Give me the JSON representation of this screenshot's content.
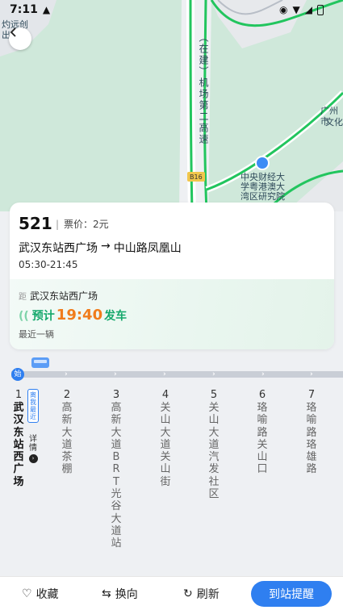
{
  "status_bar": {
    "time": "7:11"
  },
  "map": {
    "labels": {
      "top_left_1": "灼远创",
      "top_left_2": "出",
      "expressway": "（在建）机场第二高速",
      "road_shield": "B16",
      "poi_1": "中央财经大",
      "poi_2": "学粤港澳大",
      "poi_3": "湾区研究院",
      "right_1": "广州市",
      "right_2": "文化"
    }
  },
  "card": {
    "route_number": "521",
    "fare": "票价：2元",
    "origin": "武汉东站西广场",
    "arrow": "→",
    "destination": "中山路凤凰山",
    "hours": "05:30-21:45",
    "eta": {
      "station_tag": "距",
      "station": "武汉东站西广场",
      "prefix": "预计",
      "time": "19:40",
      "suffix": "发车",
      "sub": "最近一辆"
    }
  },
  "line": {
    "start_badge": "始",
    "nearest_badge": "离我最近",
    "detail": "详情",
    "stops": [
      {
        "num": "1",
        "name": "武汉东站西广场"
      },
      {
        "num": "2",
        "name": "高新大道茶棚"
      },
      {
        "num": "3",
        "name": "高新大道BRT光谷大道站"
      },
      {
        "num": "4",
        "name": "关山大道关山街"
      },
      {
        "num": "5",
        "name": "关山大道汽发社区"
      },
      {
        "num": "6",
        "name": "珞喻路关山口"
      },
      {
        "num": "7",
        "name": "珞喻路珞雄路"
      }
    ]
  },
  "bottom_bar": {
    "favorite": "收藏",
    "switch": "换向",
    "refresh": "刷新",
    "remind": "到站提醒"
  },
  "colors": {
    "accent": "#2f7ff0",
    "eta_green": "#14a86b",
    "eta_orange": "#f07c1c",
    "route_green": "#22c55e"
  }
}
